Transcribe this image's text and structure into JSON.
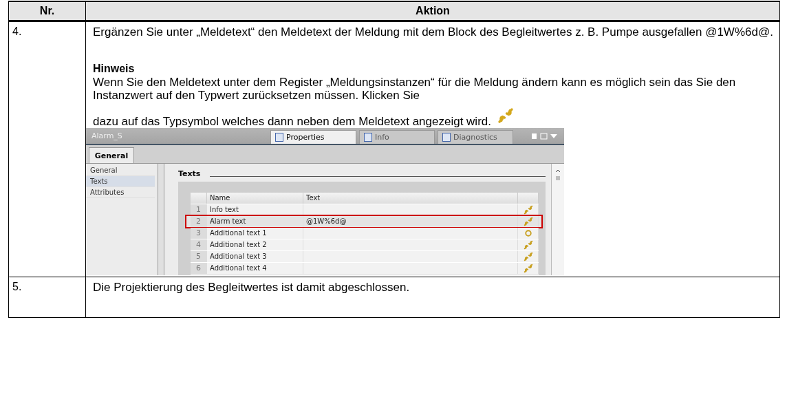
{
  "table": {
    "columns": [
      "Nr.",
      "Aktion"
    ],
    "rows": [
      {
        "nr": "4.",
        "blocks": [
          {
            "kind": "paragraph",
            "text": "Ergänzen Sie unter „Meldetext“ den Meldetext der Meldung mit dem Block des Begleitwertes z. B. Pumpe ausgefallen @1W%6d@."
          },
          {
            "kind": "heading",
            "text": "Hinweis"
          },
          {
            "kind": "paragraph",
            "text": "Wenn Sie den Meldetext unter dem Register „Meldungsinstanzen“ für die Meldung ändern kann es möglich sein das Sie den Instanzwert auf den Typwert zurücksetzen müssen. Klicken Sie"
          },
          {
            "kind": "paragraph-icon",
            "text": "dazu auf das Typsymbol welches dann neben dem Meldetext angezeigt wird."
          },
          {
            "kind": "screenshot",
            "window_title": "Alarm_S",
            "tabs": [
              {
                "label": "Properties",
                "selected": true
              },
              {
                "label": "Info",
                "selected": false
              },
              {
                "label": "Diagnostics",
                "selected": false
              }
            ],
            "section_tabs": [
              {
                "label": "General",
                "selected": true
              }
            ],
            "nav": [
              {
                "label": "General",
                "selected": false
              },
              {
                "label": "Texts",
                "selected": true
              },
              {
                "label": "Attributes",
                "selected": false
              }
            ],
            "section_title": "Texts",
            "grid_columns": [
              "Name",
              "Text"
            ],
            "grid_rows": [
              {
                "index": "1",
                "name": "Info text",
                "highlighted": false,
                "kind": "linked"
              },
              {
                "index": "2",
                "name": "Alarm text",
                "text": "@1W%6d@",
                "highlighted": true,
                "kind": "linked"
              },
              {
                "index": "3",
                "name": "Additional text 1",
                "highlighted": false,
                "kind": "unlinked"
              },
              {
                "index": "4",
                "name": "Additional text 2",
                "highlighted": false,
                "kind": "linked"
              },
              {
                "index": "5",
                "name": "Additional text 3",
                "highlighted": false,
                "kind": "linked"
              },
              {
                "index": "6",
                "name": "Additional text 4",
                "highlighted": false,
                "kind": "linked"
              }
            ]
          }
        ]
      },
      {
        "nr": "5.",
        "blocks": [
          {
            "kind": "paragraph",
            "text": "Die Projektierung des Begleitwertes ist damit abgeschlossen."
          }
        ]
      }
    ]
  }
}
